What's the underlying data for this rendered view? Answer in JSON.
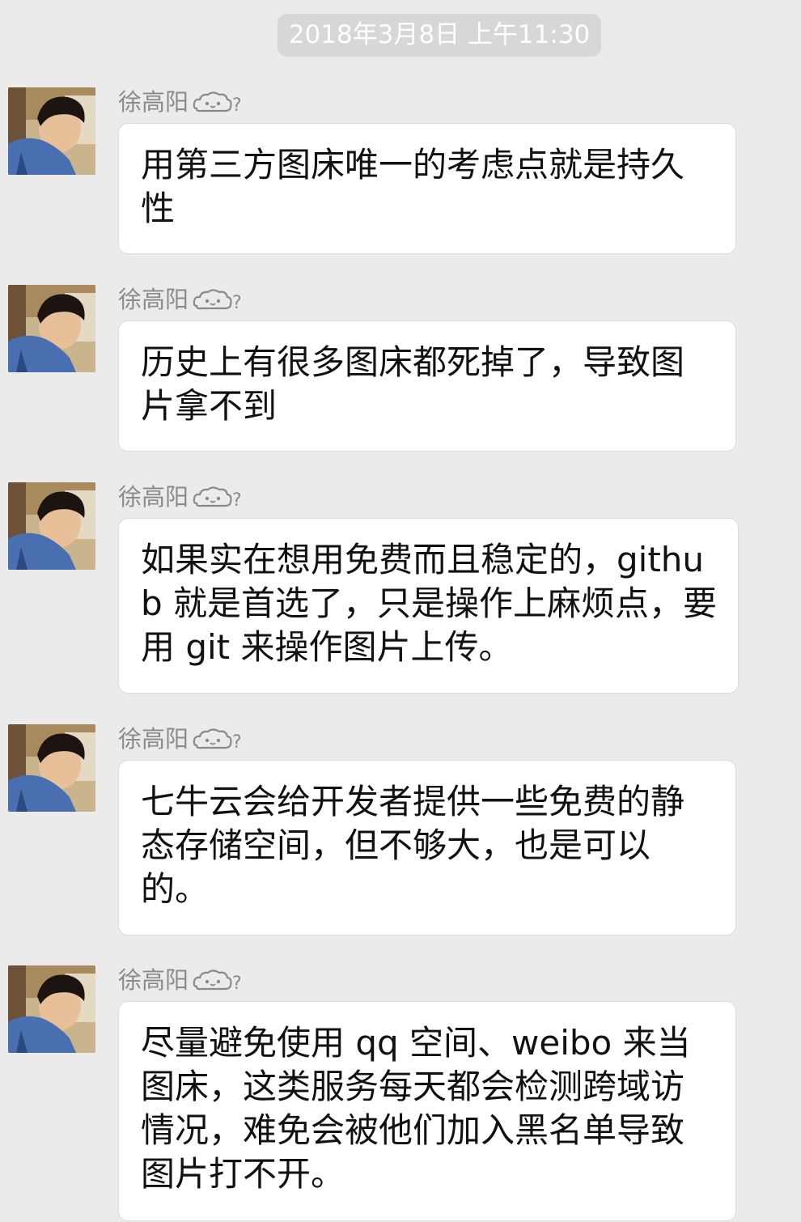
{
  "timestamp": "2018年3月8日 上午11:30",
  "sender_suffix_icon": "cloud-emoji-icon",
  "messages": [
    {
      "sender": "徐高阳",
      "text": "用第三方图床唯一的考虑点就是持久性"
    },
    {
      "sender": "徐高阳",
      "text": "历史上有很多图床都死掉了，导致图片拿不到"
    },
    {
      "sender": "徐高阳",
      "text": "如果实在想用免费而且稳定的，github 就是首选了，只是操作上麻烦点，要用 git 来操作图片上传。"
    },
    {
      "sender": "徐高阳",
      "text": "七牛云会给开发者提供一些免费的静态存储空间，但不够大，也是可以的。"
    },
    {
      "sender": "徐高阳",
      "text": "尽量避免使用 qq 空间、weibo 来当图床，这类服务每天都会检测跨域访情况，难免会被他们加入黑名单导致图片打不开。"
    }
  ]
}
